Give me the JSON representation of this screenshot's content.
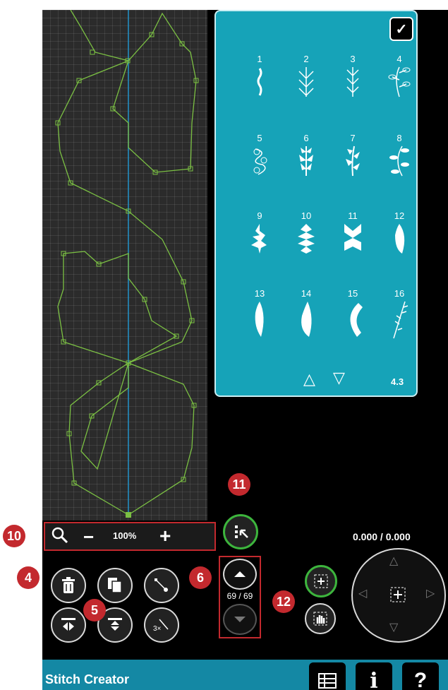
{
  "app": {
    "title": "Stitch Creator"
  },
  "zoom": {
    "level": "100%"
  },
  "stitch_menu": {
    "page": "4.3",
    "items": [
      {
        "num": "1"
      },
      {
        "num": "2"
      },
      {
        "num": "3"
      },
      {
        "num": "4"
      },
      {
        "num": "5"
      },
      {
        "num": "6"
      },
      {
        "num": "7"
      },
      {
        "num": "8"
      },
      {
        "num": "9"
      },
      {
        "num": "10"
      },
      {
        "num": "11"
      },
      {
        "num": "12"
      },
      {
        "num": "13"
      },
      {
        "num": "14"
      },
      {
        "num": "15"
      },
      {
        "num": "16"
      }
    ]
  },
  "stitch_counter": {
    "value": "69 / 69"
  },
  "position_readout": {
    "value": "0.000 / 0.000"
  },
  "callouts": {
    "c10": "10",
    "c11": "11",
    "c4": "4",
    "c5": "5",
    "c6": "6",
    "c12": "12"
  },
  "icons": {
    "confirm": "check-icon",
    "zoom": "magnifier-icon",
    "delete": "trash-icon",
    "duplicate": "duplicate-icon",
    "insert_point": "insert-point-icon",
    "mirror_side": "mirror-side-to-side-icon",
    "mirror_end": "mirror-end-to-end-icon",
    "triple": "triple-stitch-icon",
    "select": "select-point-icon",
    "prev": "chevron-up-icon",
    "next": "chevron-down-icon",
    "center": "center-icon",
    "pan": "hand-icon",
    "menu": "list-icon",
    "info": "info-icon",
    "help": "help-icon"
  },
  "colors": {
    "accent": "#16a3b8",
    "statusbar": "#1488a4",
    "callout": "#c3292e",
    "stitch_line": "#7bc043",
    "needle_line": "#1e90c8"
  }
}
